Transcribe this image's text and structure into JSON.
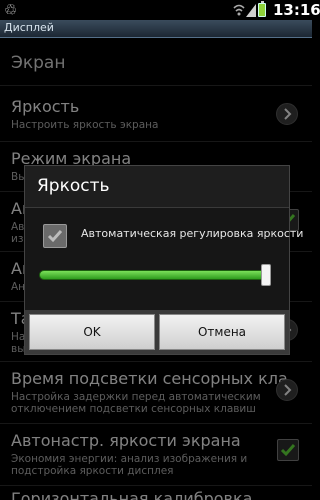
{
  "status_bar": {
    "time": "13:16",
    "icons": [
      "recycle-icon",
      "wifi-icon",
      "signal-icon",
      "battery-icon"
    ]
  },
  "title_bar": {
    "title": "Дисплей"
  },
  "settings": {
    "section_header": "Экран",
    "items": [
      {
        "title": "Яркость",
        "summary": "Настроить яркость экрана",
        "control": "chevron"
      },
      {
        "title": "Режим экрана",
        "summary": "Вы",
        "control": "none"
      },
      {
        "title": "Ав",
        "summary": "Ав",
        "summary2": "из",
        "control": "checkbox"
      },
      {
        "title": "Ан",
        "summary": "Ан",
        "control": "none"
      },
      {
        "title": "Та",
        "summary": "На",
        "summary2": "вы",
        "control": "chevron"
      },
      {
        "title": "Время подсветки сенсорных кла",
        "summary": "Настройка задержки перед автоматическим",
        "summary2": "отключением подсветки сенсорных клавиш",
        "control": "chevron"
      },
      {
        "title": "Автонастр. яркости экрана",
        "summary": "Экономия энергии: анализ изображения и",
        "summary2": "подстройка яркости дисплея",
        "control": "checkbox"
      },
      {
        "title": "Горизонтальная калибровка",
        "control": "none"
      }
    ]
  },
  "dialog": {
    "title": "Яркость",
    "auto_label": "Автоматическая регулировка яркости",
    "auto_checked": true,
    "brightness_level": 1.0,
    "ok_label": "OK",
    "cancel_label": "Отмена"
  },
  "colors": {
    "accent_green": "#4fc630",
    "titlebar": "#2a3846"
  }
}
